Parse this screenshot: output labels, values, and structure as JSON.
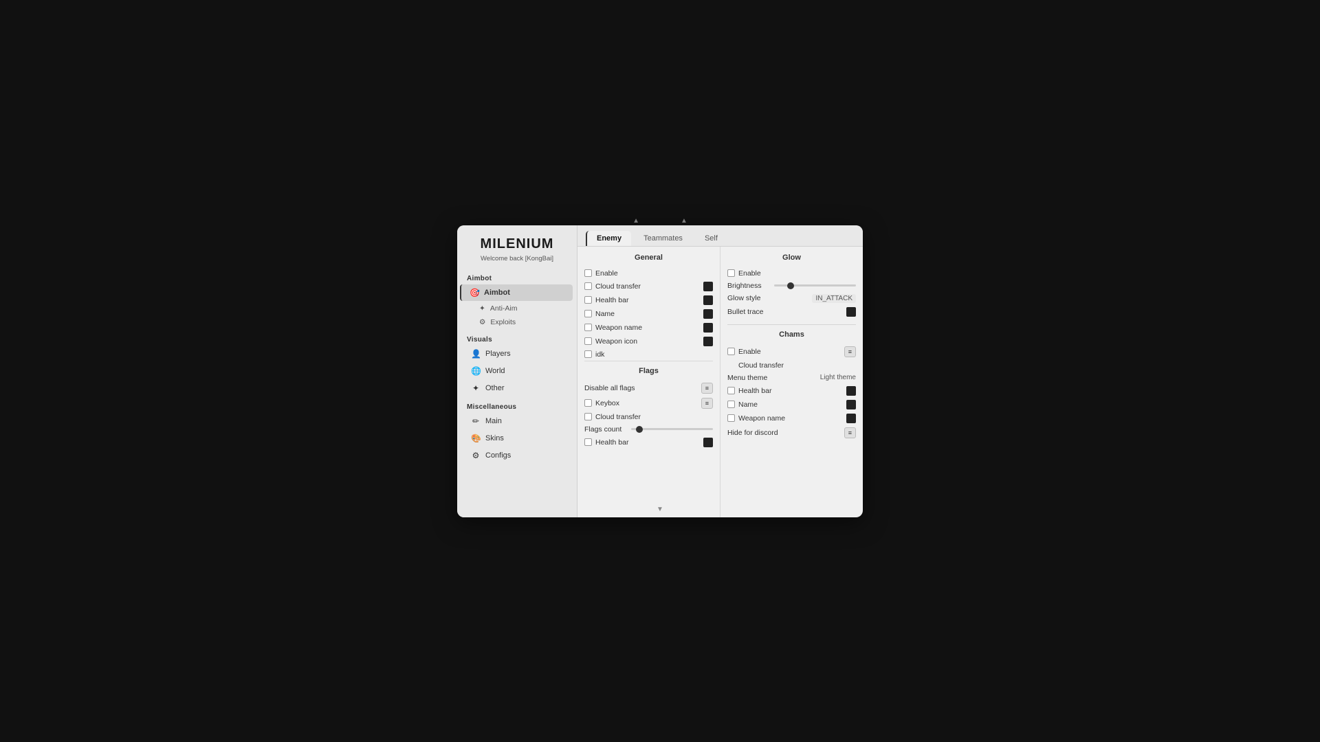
{
  "app": {
    "title": "MILENIUM",
    "welcome": "Welcome back [KongBai]"
  },
  "sidebar": {
    "sections": [
      {
        "label": "Aimbot",
        "items": [
          {
            "id": "aimbot",
            "label": "Aimbot",
            "icon": "🎯",
            "active": true,
            "isMain": true
          },
          {
            "id": "anti-aim",
            "label": "Anti-Aim",
            "icon": "✦",
            "active": false,
            "isMain": false
          },
          {
            "id": "exploits",
            "label": "Exploits",
            "icon": "⚙",
            "active": false,
            "isMain": false
          }
        ]
      },
      {
        "label": "Visuals",
        "items": [
          {
            "id": "players",
            "label": "Players",
            "icon": "👤",
            "active": false,
            "isMain": true
          },
          {
            "id": "world",
            "label": "World",
            "icon": "🌐",
            "active": false,
            "isMain": true
          },
          {
            "id": "other",
            "label": "Other",
            "icon": "✦",
            "active": false,
            "isMain": true
          }
        ]
      },
      {
        "label": "Miscellaneous",
        "items": [
          {
            "id": "main",
            "label": "Main",
            "icon": "✏",
            "active": false,
            "isMain": true
          },
          {
            "id": "skins",
            "label": "Skins",
            "icon": "🎨",
            "active": false,
            "isMain": true
          },
          {
            "id": "configs",
            "label": "Configs",
            "icon": "⚙",
            "active": false,
            "isMain": true
          }
        ]
      }
    ]
  },
  "tabs": [
    {
      "id": "enemy",
      "label": "Enemy",
      "active": true
    },
    {
      "id": "teammates",
      "label": "Teammates",
      "active": false
    },
    {
      "id": "self",
      "label": "Self",
      "active": false
    }
  ],
  "general": {
    "heading": "General",
    "items": [
      {
        "id": "enable",
        "label": "Enable",
        "checked": false
      },
      {
        "id": "cloud-transfer",
        "label": "Cloud transfer",
        "checked": false,
        "hasColor": true
      },
      {
        "id": "health-bar",
        "label": "Health bar",
        "checked": false,
        "hasColor": true
      },
      {
        "id": "name",
        "label": "Name",
        "checked": false,
        "hasColor": true
      },
      {
        "id": "weapon-name",
        "label": "Weapon name",
        "checked": false,
        "hasColor": true
      },
      {
        "id": "weapon-icon",
        "label": "Weapon icon",
        "checked": false,
        "hasColor": true
      },
      {
        "id": "idk",
        "label": "idk",
        "checked": false
      }
    ]
  },
  "flags": {
    "heading": "Flags",
    "disable_all_label": "Disable all flags",
    "items": [
      {
        "id": "keybox",
        "label": "Keybox",
        "checked": false
      },
      {
        "id": "cloud-transfer-f",
        "label": "Cloud transfer",
        "checked": false
      },
      {
        "id": "flags-count",
        "label": "Flags count",
        "sliderValue": 10
      },
      {
        "id": "health-bar-f",
        "label": "Health bar",
        "checked": false,
        "hasColor": true
      }
    ]
  },
  "glow": {
    "heading": "Glow",
    "enable_checked": false,
    "brightness_label": "Brightness",
    "brightness_value": 20,
    "glow_style_label": "Glow style",
    "glow_style_value": "IN_ATTACK",
    "bullet_trace_label": "Bullet trace"
  },
  "chams": {
    "heading": "Chams",
    "enable_checked": false,
    "cloud_transfer_label": "Cloud transfer",
    "menu_theme_label": "Menu theme",
    "menu_theme_value": "Light theme",
    "items_chams": [
      {
        "id": "health-bar-c",
        "label": "Health bar",
        "checked": false,
        "hasColor": true
      },
      {
        "id": "name-c",
        "label": "Name",
        "checked": false,
        "hasColor": true
      },
      {
        "id": "weapon-name-c",
        "label": "Weapon name",
        "checked": false,
        "hasColor": true
      }
    ],
    "hide_discord_label": "Hide for discord"
  }
}
